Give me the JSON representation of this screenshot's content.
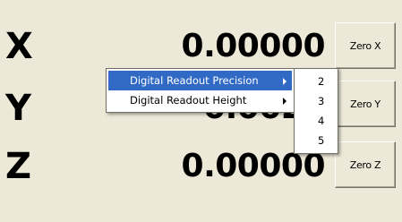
{
  "readout": {
    "x": {
      "label": "X",
      "value": "0.00000",
      "zero_button": "Zero X"
    },
    "y": {
      "label": "Y",
      "value": "0.0025",
      "zero_button": "Zero Y"
    },
    "z": {
      "label": "Z",
      "value": "0.00000",
      "zero_button": "Zero Z"
    }
  },
  "context_menu": {
    "items": [
      {
        "label": "Digital Readout Precision",
        "selected": true,
        "has_submenu": true
      },
      {
        "label": "Digital Readout Height",
        "selected": false,
        "has_submenu": true
      }
    ]
  },
  "precision_submenu": {
    "options": [
      "2",
      "3",
      "4",
      "5"
    ]
  },
  "colors": {
    "background": "#ece9d8",
    "menu_highlight": "#316ac5"
  }
}
